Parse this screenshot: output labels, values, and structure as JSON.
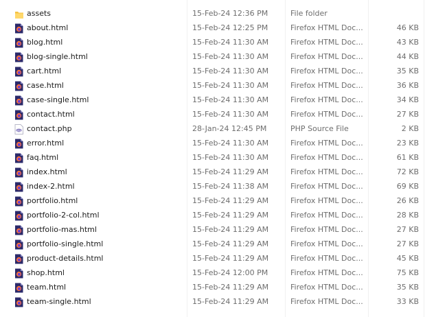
{
  "files": [
    {
      "name": "assets",
      "modified": "15-Feb-24 12:36 PM",
      "type": "File folder",
      "size": "",
      "icon": "folder-icon"
    },
    {
      "name": "about.html",
      "modified": "15-Feb-24 12:25 PM",
      "type": "Firefox HTML Doc...",
      "size": "46 KB",
      "icon": "firefox-html-file-icon"
    },
    {
      "name": "blog.html",
      "modified": "15-Feb-24 11:30 AM",
      "type": "Firefox HTML Doc...",
      "size": "43 KB",
      "icon": "firefox-html-file-icon"
    },
    {
      "name": "blog-single.html",
      "modified": "15-Feb-24 11:30 AM",
      "type": "Firefox HTML Doc...",
      "size": "44 KB",
      "icon": "firefox-html-file-icon"
    },
    {
      "name": "cart.html",
      "modified": "15-Feb-24 11:30 AM",
      "type": "Firefox HTML Doc...",
      "size": "35 KB",
      "icon": "firefox-html-file-icon"
    },
    {
      "name": "case.html",
      "modified": "15-Feb-24 11:30 AM",
      "type": "Firefox HTML Doc...",
      "size": "36 KB",
      "icon": "firefox-html-file-icon"
    },
    {
      "name": "case-single.html",
      "modified": "15-Feb-24 11:30 AM",
      "type": "Firefox HTML Doc...",
      "size": "34 KB",
      "icon": "firefox-html-file-icon"
    },
    {
      "name": "contact.html",
      "modified": "15-Feb-24 11:30 AM",
      "type": "Firefox HTML Doc...",
      "size": "27 KB",
      "icon": "firefox-html-file-icon"
    },
    {
      "name": "contact.php",
      "modified": "28-Jan-24 12:45 PM",
      "type": "PHP Source File",
      "size": "2 KB",
      "icon": "php-file-icon"
    },
    {
      "name": "error.html",
      "modified": "15-Feb-24 11:30 AM",
      "type": "Firefox HTML Doc...",
      "size": "23 KB",
      "icon": "firefox-html-file-icon"
    },
    {
      "name": "faq.html",
      "modified": "15-Feb-24 11:30 AM",
      "type": "Firefox HTML Doc...",
      "size": "61 KB",
      "icon": "firefox-html-file-icon"
    },
    {
      "name": "index.html",
      "modified": "15-Feb-24 11:29 AM",
      "type": "Firefox HTML Doc...",
      "size": "72 KB",
      "icon": "firefox-html-file-icon"
    },
    {
      "name": "index-2.html",
      "modified": "15-Feb-24 11:38 AM",
      "type": "Firefox HTML Doc...",
      "size": "69 KB",
      "icon": "firefox-html-file-icon"
    },
    {
      "name": "portfolio.html",
      "modified": "15-Feb-24 11:29 AM",
      "type": "Firefox HTML Doc...",
      "size": "26 KB",
      "icon": "firefox-html-file-icon"
    },
    {
      "name": "portfolio-2-col.html",
      "modified": "15-Feb-24 11:29 AM",
      "type": "Firefox HTML Doc...",
      "size": "28 KB",
      "icon": "firefox-html-file-icon"
    },
    {
      "name": "portfolio-mas.html",
      "modified": "15-Feb-24 11:29 AM",
      "type": "Firefox HTML Doc...",
      "size": "27 KB",
      "icon": "firefox-html-file-icon"
    },
    {
      "name": "portfolio-single.html",
      "modified": "15-Feb-24 11:29 AM",
      "type": "Firefox HTML Doc...",
      "size": "27 KB",
      "icon": "firefox-html-file-icon"
    },
    {
      "name": "product-details.html",
      "modified": "15-Feb-24 11:29 AM",
      "type": "Firefox HTML Doc...",
      "size": "45 KB",
      "icon": "firefox-html-file-icon"
    },
    {
      "name": "shop.html",
      "modified": "15-Feb-24 12:00 PM",
      "type": "Firefox HTML Doc...",
      "size": "75 KB",
      "icon": "firefox-html-file-icon"
    },
    {
      "name": "team.html",
      "modified": "15-Feb-24 11:29 AM",
      "type": "Firefox HTML Doc...",
      "size": "35 KB",
      "icon": "firefox-html-file-icon"
    },
    {
      "name": "team-single.html",
      "modified": "15-Feb-24 11:29 AM",
      "type": "Firefox HTML Doc...",
      "size": "33 KB",
      "icon": "firefox-html-file-icon"
    }
  ],
  "colors": {
    "folder": "#f5c242",
    "firefox_doc": "#2b2a6b",
    "firefox_flame": "#ff7139",
    "php_doc": "#8a7fc2",
    "secondary_text": "#6d6d6d"
  }
}
